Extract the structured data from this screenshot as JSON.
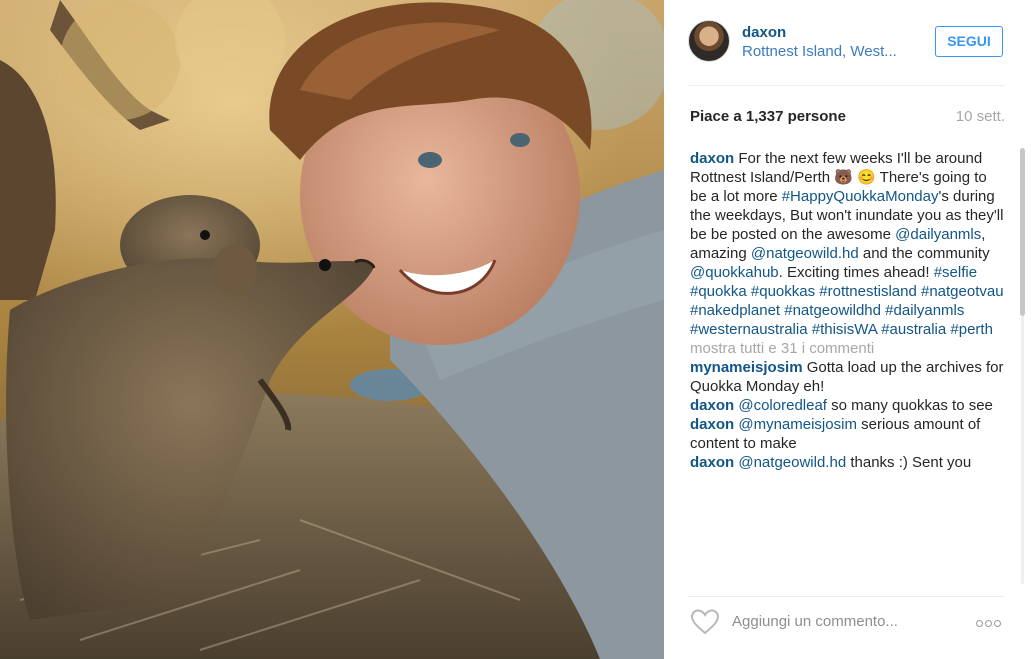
{
  "photo": {
    "alt": ""
  },
  "header": {
    "username": "daxon",
    "location": "Rottnest Island, West...",
    "follow_label": "SEGUI"
  },
  "stats": {
    "likes_label": "Piace a 1,337 persone",
    "time_ago": "10 sett."
  },
  "caption": {
    "user": "daxon",
    "parts": [
      " For the next few weeks I'll be around Rottnest Island/Perth 🐻 😊 There's going to be a lot more ",
      "#HappyQuokkaMonday",
      "'s during the weekdays, But won't inundate you as they'll be be posted on the awesome ",
      "@dailyanmls",
      ", amazing ",
      "@natgeowild.hd",
      " and the community ",
      "@quokkahub",
      ". Exciting times ahead! ",
      "#selfie #quokka #quokkas #rottnestisland #natgeotvau #nakedplanet #natgeowildhd #dailyanmls #westernaustralia #thisisWA #australia #perth"
    ]
  },
  "show_all": "mostra tutti e 31 i commenti",
  "comments": [
    {
      "user": "mynameisjosim",
      "mention": "",
      "text": " Gotta load up the archives for Quokka Monday eh!"
    },
    {
      "user": "daxon",
      "mention": "@coloredleaf",
      "text": " so many quokkas to see"
    },
    {
      "user": "daxon",
      "mention": "@mynameisjosim",
      "text": " serious amount of content to make"
    },
    {
      "user": "daxon",
      "mention": "@natgeowild.hd",
      "text": " thanks :) Sent you"
    }
  ],
  "footer": {
    "add_comment_placeholder": "Aggiungi un commento...",
    "heart_icon": "heart-outline-icon",
    "more_icon": "more-options-icon"
  },
  "colors": {
    "link": "#125688",
    "follow": "#3897f0",
    "muted": "#a5a7aa"
  }
}
